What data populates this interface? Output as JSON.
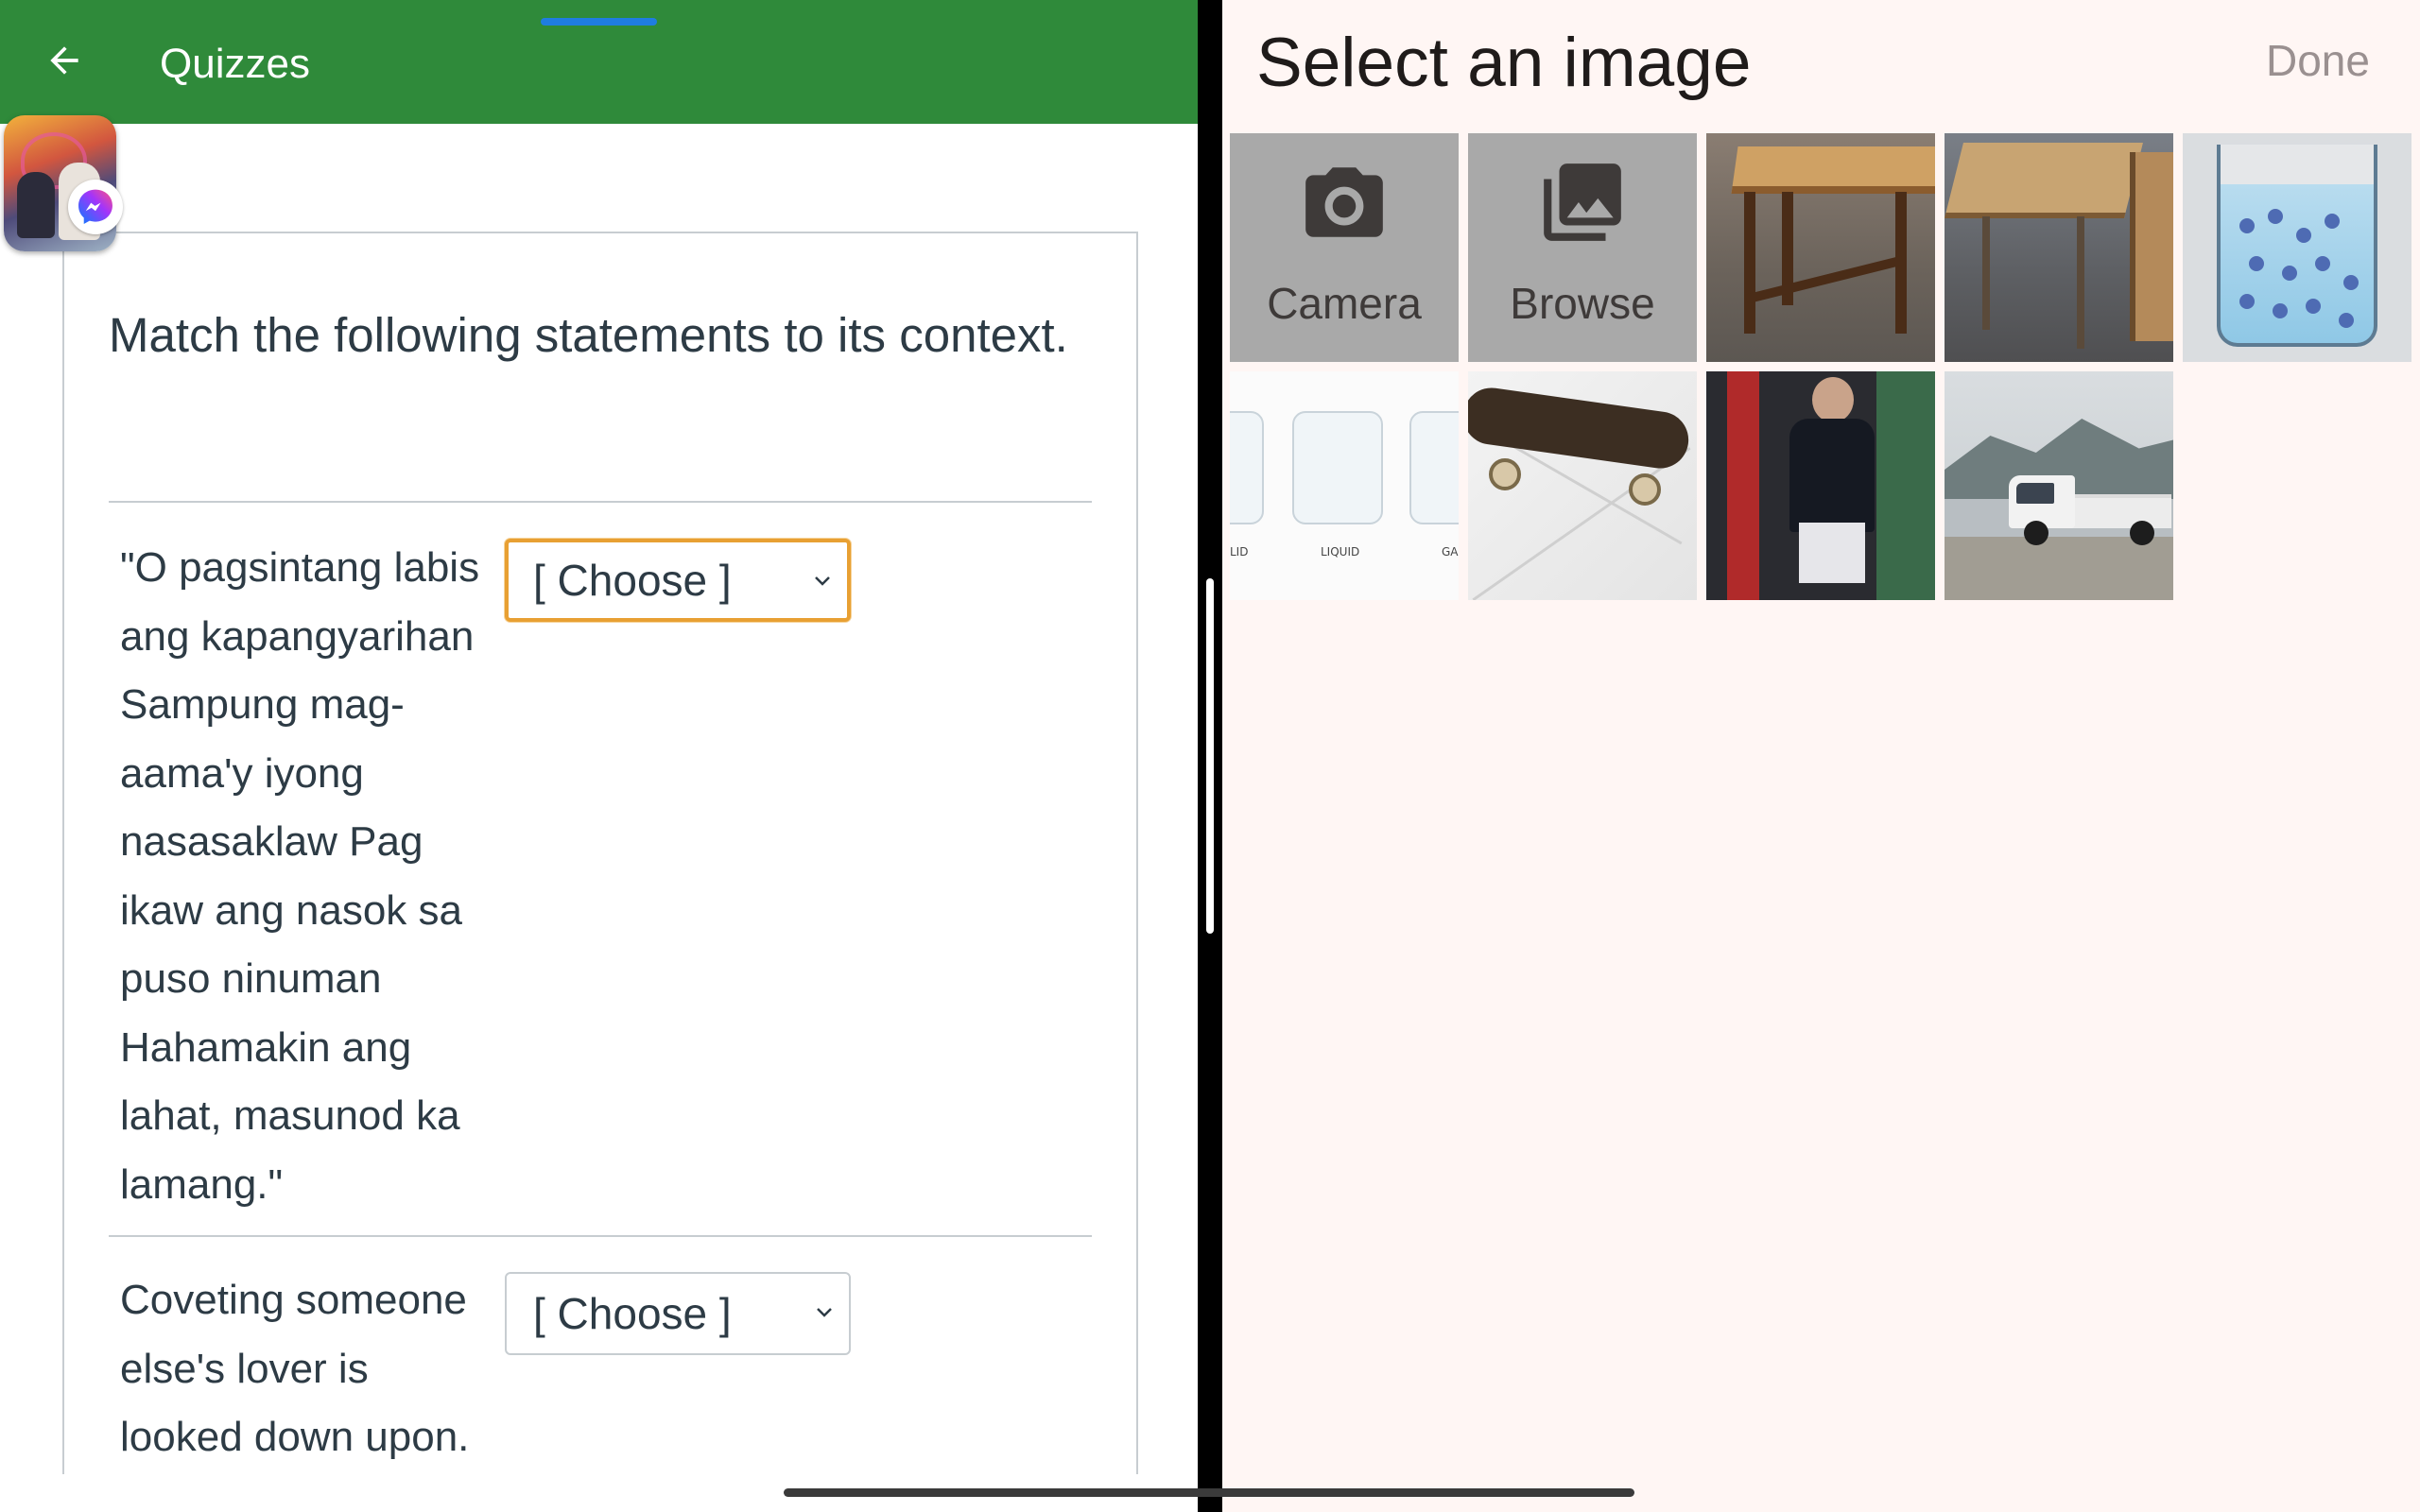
{
  "quiz_app": {
    "title": "Quizzes",
    "question": {
      "prompt": "Match the following statements to its context.",
      "items": [
        {
          "statement": "\"O pagsintang labis ang kapangyarihan Sampung mag-aama'y iyong nasasaklaw Pag ikaw ang nasok sa puso ninuman Hahamakin ang lahat, masunod ka lamang.\"",
          "lines": [
            "\"O pagsintang labis",
            "ang kapangyarihan",
            "Sampung mag-",
            "aama'y iyong",
            "nasasaklaw Pag",
            "ikaw ang nasok sa",
            "puso ninuman",
            "Hahamakin ang",
            "lahat, masunod ka",
            "lamang.\""
          ],
          "selected": "[ Choose ]",
          "focused": true
        },
        {
          "statement": "Coveting someone else's lover is looked down upon.",
          "lines": [
            "Coveting someone",
            "else's lover is",
            "looked down upon."
          ],
          "selected": "[ Choose ]",
          "focused": false
        }
      ]
    }
  },
  "image_picker": {
    "title": "Select an image",
    "done_label": "Done",
    "actions": [
      {
        "label": "Camera",
        "icon": "camera-icon"
      },
      {
        "label": "Browse",
        "icon": "gallery-icon"
      }
    ],
    "photos": [
      {
        "name": "photo-wooden-table"
      },
      {
        "name": "photo-drafting-table"
      },
      {
        "name": "photo-beaker-particles"
      },
      {
        "name": "photo-states-of-matter",
        "labels": [
          "LID",
          "LIQUID",
          "GA"
        ]
      },
      {
        "name": "photo-skateboard"
      },
      {
        "name": "photo-mirror-selfie"
      },
      {
        "name": "photo-white-truck"
      }
    ]
  },
  "colors": {
    "app_bar": "#2f8a3a",
    "focus_ring": "#e8a033",
    "picker_bg": "#fff6f4",
    "tile_gray": "#a9a9a9"
  }
}
